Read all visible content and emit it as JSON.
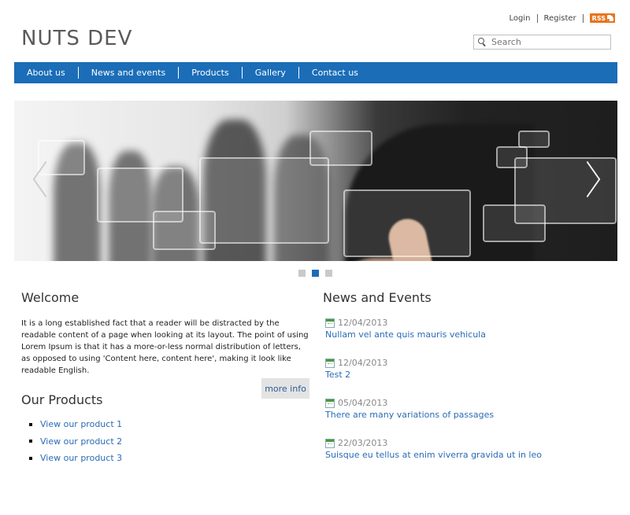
{
  "header": {
    "login_label": "Login",
    "register_label": "Register",
    "rss_label": "RSS",
    "logo_text": "NUTS DEV",
    "search_placeholder": "Search"
  },
  "nav": {
    "items": [
      {
        "label": "About us"
      },
      {
        "label": "News and events"
      },
      {
        "label": "Products"
      },
      {
        "label": "Gallery"
      },
      {
        "label": "Contact us"
      }
    ]
  },
  "slider": {
    "slide_count": 3,
    "active_slide": 2
  },
  "welcome": {
    "title": "Welcome",
    "text": "It is a long established fact that a reader will be distracted by the readable content of a page when looking at its layout. The point of using Lorem Ipsum is that it has a more-or-less normal distribution of letters, as opposed to using 'Content here, content here', making it look like readable English.",
    "more_info_label": "more info"
  },
  "products": {
    "title": "Our Products",
    "items": [
      {
        "label": "View our product 1"
      },
      {
        "label": "View our product 2"
      },
      {
        "label": "View our product 3"
      }
    ]
  },
  "news": {
    "title": "News and Events",
    "items": [
      {
        "date": "12/04/2013",
        "title": "Nullam vel ante quis mauris vehicula"
      },
      {
        "date": "12/04/2013",
        "title": "Test 2"
      },
      {
        "date": "05/04/2013",
        "title": "There are many variations of passages"
      },
      {
        "date": "22/03/2013",
        "title": "Suisque eu tellus at enim viverra gravida ut in leo"
      }
    ]
  },
  "colors": {
    "nav_background": "#1b6db8",
    "link": "#2a6bb5",
    "rss": "#e8731c",
    "active_dot": "#1b6db8"
  }
}
